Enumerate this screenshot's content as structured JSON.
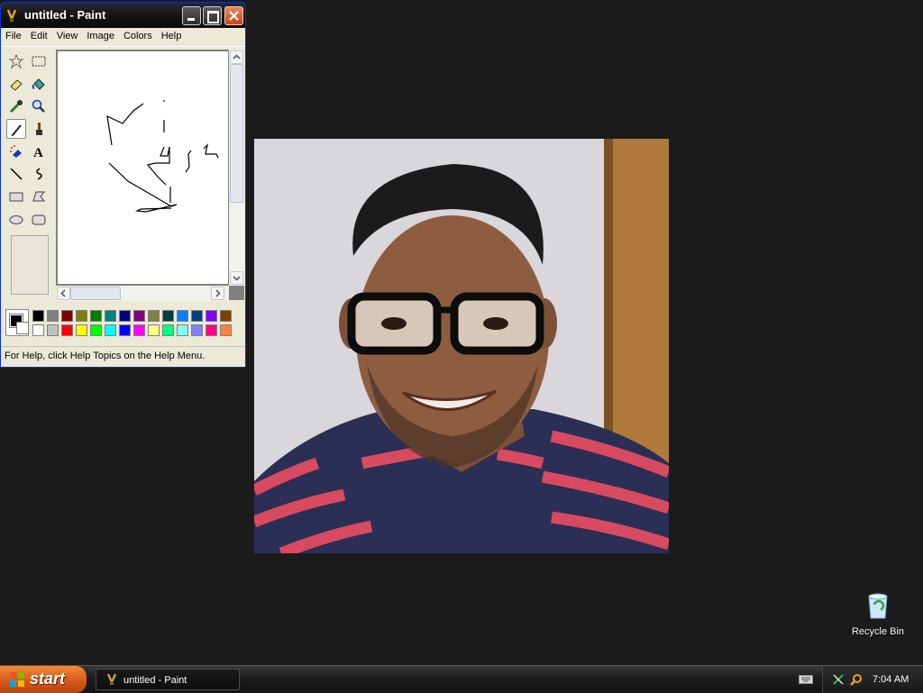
{
  "paint_window": {
    "title": "untitled - Paint",
    "menu": [
      "File",
      "Edit",
      "View",
      "Image",
      "Colors",
      "Help"
    ],
    "tools": [
      "free-form-select",
      "select",
      "eraser",
      "fill-with-color",
      "pick-color",
      "magnifier",
      "pencil",
      "brush",
      "airbrush",
      "text",
      "line",
      "curve",
      "rectangle",
      "polygon",
      "ellipse",
      "rounded-rectangle"
    ],
    "selected_tool": "pencil",
    "foreground_color": "#000000",
    "background_color": "#ffffff",
    "palette_top": [
      "#000000",
      "#808080",
      "#800000",
      "#808000",
      "#008000",
      "#008080",
      "#000080",
      "#800080",
      "#808040",
      "#004040",
      "#0080ff",
      "#004080",
      "#8000ff",
      "#804000"
    ],
    "palette_bottom": [
      "#ffffff",
      "#c0c0c0",
      "#ff0000",
      "#ffff00",
      "#00ff00",
      "#00ffff",
      "#0000ff",
      "#ff00ff",
      "#ffff80",
      "#00ff80",
      "#80ffff",
      "#8080ff",
      "#ff0080",
      "#ff8040"
    ],
    "status_text": "For Help, click Help Topics on the Help Menu."
  },
  "desktop": {
    "recycle_bin_label": "Recycle Bin"
  },
  "taskbar": {
    "start_label": "start",
    "task_label": "untitled - Paint",
    "clock": "7:04 AM"
  }
}
